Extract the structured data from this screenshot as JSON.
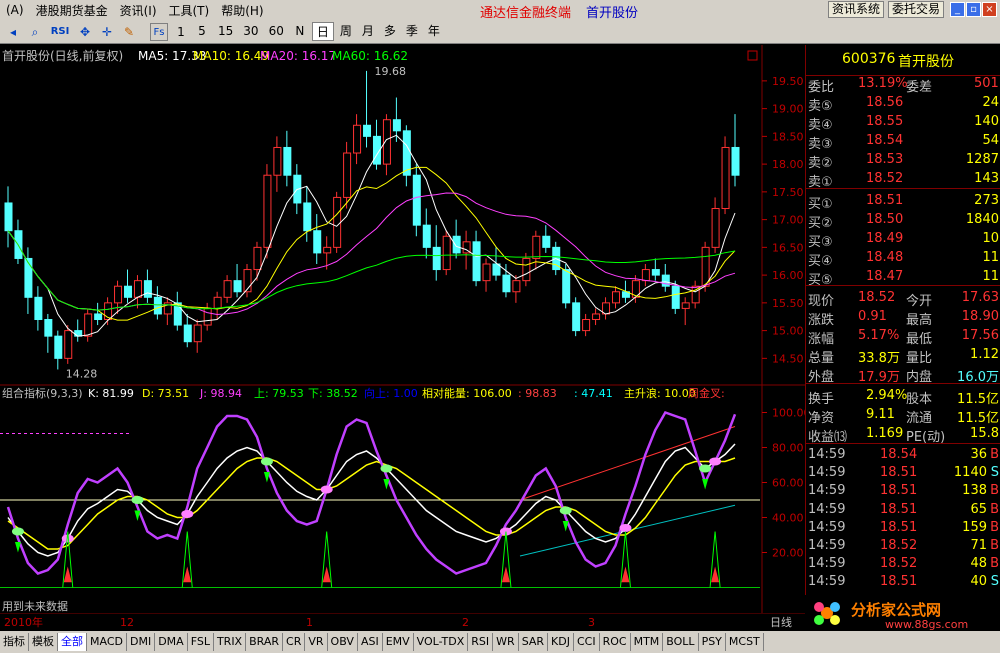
{
  "menu": {
    "items": [
      "(A)",
      "港股期货基金",
      "资讯(I)",
      "工具(T)",
      "帮助(H)"
    ],
    "center_title": "通达信金融终端",
    "center_stock": "首开股份",
    "right_buttons": [
      "资讯系统",
      "委托交易"
    ]
  },
  "toolbar": {
    "periods": [
      "5",
      "15",
      "30",
      "60",
      "N",
      "日",
      "周",
      "月",
      "多",
      "季",
      "年"
    ],
    "selected": "日",
    "icons": [
      "back-icon",
      "magnifier-icon",
      "rsi-icon",
      "pan-icon",
      "cross-icon",
      "pencil-icon",
      "fs-icon",
      "1-icon"
    ],
    "rsi_label": "RSI",
    "fs_label": "Fs",
    "one_label": "1"
  },
  "main_chart": {
    "header": "首开股份(日线,前复权)",
    "ma": [
      {
        "label": "MA5: 17.33",
        "color": "#ffffff"
      },
      {
        "label": "MA10: 16.49",
        "color": "#ffff00"
      },
      {
        "label": "MA20: 16.17",
        "color": "#ff40ff"
      },
      {
        "label": "MA60: 16.62",
        "color": "#00ff00"
      }
    ],
    "high_label": "19.68",
    "low_label": "14.28",
    "y_ticks": [
      "19.50",
      "19.00",
      "18.50",
      "18.00",
      "17.50",
      "17.00",
      "16.50",
      "16.00",
      "15.50",
      "15.00",
      "14.50"
    ],
    "ylim": [
      14.2,
      19.75
    ],
    "colors": {
      "up": "#ff3232",
      "down": "#54ffff",
      "ma5": "#ffffff",
      "ma10": "#ffff00",
      "ma20": "#ff40ff",
      "ma60": "#00ff00"
    }
  },
  "indicator": {
    "header_name": "组合指标(9,3,3)",
    "items": [
      {
        "label": "K: 81.99",
        "color": "#ffffff"
      },
      {
        "label": "D: 73.51",
        "color": "#ffff00"
      },
      {
        "label": "J: 98.94",
        "color": "#ff40ff"
      },
      {
        "label": "上: 79.53",
        "color": "#00ff00"
      },
      {
        "label": "下: 38.52",
        "color": "#00ff00"
      },
      {
        "label": "向上: 1.00",
        "color": "#0000ff"
      },
      {
        "label": "相对能量: 106.00",
        "color": "#ffff00"
      },
      {
        "label": ": 98.83",
        "color": "#ff4040"
      },
      {
        "label": ": 47.41",
        "color": "#00ffff"
      },
      {
        "label": "主升浪: 10.00",
        "color": "#ffff00"
      },
      {
        "label": "周金叉:",
        "color": "#ff3232"
      }
    ],
    "y_ticks": [
      "100.00",
      "80.00",
      "60.00",
      "40.00",
      "20.00"
    ],
    "ylim": [
      -10,
      110
    ],
    "footer_note": "用到未来数据"
  },
  "x_axis": {
    "labels": [
      "2010年",
      "12",
      "1",
      "2",
      "3",
      "日线"
    ]
  },
  "chart_data": [
    {
      "type": "candlestick",
      "title": "首开股份(日线,前复权)",
      "ylim": [
        14.2,
        19.75
      ],
      "candles": [
        [
          17.3,
          17.6,
          16.5,
          16.8
        ],
        [
          16.8,
          17.0,
          16.2,
          16.3
        ],
        [
          16.3,
          16.5,
          15.3,
          15.6
        ],
        [
          15.6,
          15.8,
          15.0,
          15.2
        ],
        [
          15.2,
          15.3,
          14.6,
          14.9
        ],
        [
          14.9,
          15.0,
          14.3,
          14.5
        ],
        [
          14.5,
          15.1,
          14.4,
          15.0
        ],
        [
          15.0,
          15.2,
          14.8,
          14.9
        ],
        [
          14.9,
          15.4,
          14.8,
          15.3
        ],
        [
          15.3,
          15.5,
          15.1,
          15.2
        ],
        [
          15.2,
          15.6,
          15.1,
          15.5
        ],
        [
          15.5,
          15.9,
          15.3,
          15.8
        ],
        [
          15.8,
          16.1,
          15.5,
          15.6
        ],
        [
          15.6,
          16.0,
          15.4,
          15.9
        ],
        [
          15.9,
          16.1,
          15.5,
          15.6
        ],
        [
          15.6,
          15.8,
          15.2,
          15.3
        ],
        [
          15.3,
          15.6,
          15.1,
          15.5
        ],
        [
          15.5,
          15.7,
          15.0,
          15.1
        ],
        [
          15.1,
          15.3,
          14.7,
          14.8
        ],
        [
          14.8,
          15.2,
          14.6,
          15.1
        ],
        [
          15.1,
          15.5,
          15.0,
          15.4
        ],
        [
          15.4,
          15.7,
          15.2,
          15.6
        ],
        [
          15.6,
          16.0,
          15.5,
          15.9
        ],
        [
          15.9,
          16.2,
          15.6,
          15.7
        ],
        [
          15.7,
          16.2,
          15.6,
          16.1
        ],
        [
          16.1,
          16.6,
          15.9,
          16.5
        ],
        [
          16.5,
          18.0,
          16.3,
          17.8
        ],
        [
          17.8,
          18.5,
          17.5,
          18.3
        ],
        [
          18.3,
          18.6,
          17.6,
          17.8
        ],
        [
          17.8,
          18.0,
          17.1,
          17.3
        ],
        [
          17.3,
          17.6,
          16.6,
          16.8
        ],
        [
          16.8,
          17.1,
          16.2,
          16.4
        ],
        [
          16.4,
          16.7,
          16.1,
          16.5
        ],
        [
          16.5,
          17.5,
          16.4,
          17.4
        ],
        [
          17.4,
          18.4,
          17.2,
          18.2
        ],
        [
          18.2,
          18.9,
          18.0,
          18.7
        ],
        [
          18.7,
          19.68,
          18.3,
          18.5
        ],
        [
          18.5,
          18.8,
          17.9,
          18.0
        ],
        [
          18.0,
          18.9,
          17.8,
          18.8
        ],
        [
          18.8,
          19.2,
          18.4,
          18.6
        ],
        [
          18.6,
          18.7,
          17.6,
          17.8
        ],
        [
          17.8,
          18.0,
          16.7,
          16.9
        ],
        [
          16.9,
          17.2,
          16.3,
          16.5
        ],
        [
          16.5,
          16.9,
          15.9,
          16.1
        ],
        [
          16.1,
          16.8,
          16.0,
          16.7
        ],
        [
          16.7,
          17.0,
          16.3,
          16.4
        ],
        [
          16.4,
          16.8,
          16.1,
          16.6
        ],
        [
          16.6,
          16.8,
          15.8,
          15.9
        ],
        [
          15.9,
          16.3,
          15.7,
          16.2
        ],
        [
          16.2,
          16.5,
          15.9,
          16.0
        ],
        [
          16.0,
          16.2,
          15.6,
          15.7
        ],
        [
          15.7,
          16.0,
          15.5,
          15.9
        ],
        [
          15.9,
          16.4,
          15.8,
          16.3
        ],
        [
          16.3,
          16.8,
          16.1,
          16.7
        ],
        [
          16.7,
          16.9,
          16.4,
          16.5
        ],
        [
          16.5,
          16.6,
          16.0,
          16.1
        ],
        [
          16.1,
          16.2,
          15.4,
          15.5
        ],
        [
          15.5,
          15.6,
          14.9,
          15.0
        ],
        [
          15.0,
          15.3,
          14.9,
          15.2
        ],
        [
          15.2,
          15.4,
          15.1,
          15.3
        ],
        [
          15.3,
          15.6,
          15.2,
          15.5
        ],
        [
          15.5,
          15.8,
          15.4,
          15.7
        ],
        [
          15.7,
          15.9,
          15.5,
          15.6
        ],
        [
          15.6,
          16.0,
          15.5,
          15.9
        ],
        [
          15.9,
          16.2,
          15.8,
          16.1
        ],
        [
          16.1,
          16.3,
          15.9,
          16.0
        ],
        [
          16.0,
          16.2,
          15.7,
          15.8
        ],
        [
          15.8,
          15.9,
          15.3,
          15.4
        ],
        [
          15.4,
          15.6,
          15.1,
          15.5
        ],
        [
          15.5,
          15.9,
          15.4,
          15.8
        ],
        [
          15.8,
          16.6,
          15.7,
          16.5
        ],
        [
          16.5,
          17.4,
          16.4,
          17.2
        ],
        [
          17.2,
          18.5,
          17.1,
          18.3
        ],
        [
          18.3,
          18.9,
          17.6,
          17.8
        ]
      ]
    },
    {
      "type": "line",
      "title": "组合指标(9,3,3)",
      "ylim": [
        -10,
        110
      ],
      "series": [
        {
          "name": "K",
          "values": [
            40,
            32,
            25,
            20,
            18,
            20,
            28,
            38,
            45,
            48,
            52,
            56,
            55,
            50,
            44,
            40,
            38,
            36,
            42,
            52,
            60,
            68,
            74,
            78,
            80,
            78,
            72,
            66,
            60,
            55,
            52,
            50,
            56,
            64,
            72,
            76,
            78,
            74,
            68,
            62,
            56,
            50,
            44,
            40,
            36,
            32,
            30,
            28,
            26,
            28,
            32,
            36,
            42,
            48,
            52,
            50,
            44,
            38,
            32,
            28,
            26,
            28,
            34,
            42,
            52,
            62,
            72,
            78,
            80,
            74,
            68,
            72,
            76,
            82
          ]
        },
        {
          "name": "D",
          "values": [
            38,
            34,
            30,
            26,
            22,
            22,
            24,
            30,
            36,
            42,
            46,
            50,
            52,
            52,
            50,
            46,
            42,
            40,
            40,
            44,
            50,
            56,
            62,
            68,
            72,
            74,
            74,
            72,
            68,
            64,
            60,
            56,
            56,
            58,
            62,
            66,
            70,
            72,
            70,
            68,
            64,
            60,
            56,
            52,
            48,
            44,
            40,
            36,
            32,
            30,
            30,
            32,
            36,
            40,
            44,
            46,
            46,
            44,
            40,
            36,
            32,
            30,
            30,
            34,
            40,
            48,
            56,
            64,
            70,
            72,
            72,
            72,
            72,
            74
          ]
        },
        {
          "name": "J",
          "values": [
            46,
            28,
            14,
            8,
            10,
            16,
            36,
            54,
            62,
            60,
            64,
            68,
            60,
            46,
            32,
            28,
            30,
            28,
            46,
            68,
            80,
            92,
            98,
            98,
            96,
            86,
            68,
            54,
            44,
            38,
            36,
            38,
            56,
            76,
            92,
            96,
            94,
            78,
            64,
            50,
            40,
            30,
            22,
            16,
            12,
            8,
            10,
            12,
            14,
            24,
            36,
            44,
            54,
            64,
            68,
            58,
            40,
            26,
            16,
            12,
            14,
            24,
            42,
            58,
            76,
            90,
            100,
            98,
            96,
            78,
            60,
            72,
            84,
            99
          ]
        }
      ],
      "annotations": [
        "用到未来数据"
      ]
    }
  ],
  "sidepanel": {
    "title_code": "600376",
    "title_name": "首开股份",
    "weibi_label": "委比",
    "weibi_value": "13.19%",
    "weicha_label": "委差",
    "weicha_value": "501",
    "sell": [
      {
        "label": "卖⑤",
        "price": "18.56",
        "vol": "24"
      },
      {
        "label": "卖④",
        "price": "18.55",
        "vol": "140"
      },
      {
        "label": "卖③",
        "price": "18.54",
        "vol": "54"
      },
      {
        "label": "卖②",
        "price": "18.53",
        "vol": "1287"
      },
      {
        "label": "卖①",
        "price": "18.52",
        "vol": "143"
      }
    ],
    "buy": [
      {
        "label": "买①",
        "price": "18.51",
        "vol": "273"
      },
      {
        "label": "买②",
        "price": "18.50",
        "vol": "1840"
      },
      {
        "label": "买③",
        "price": "18.49",
        "vol": "10"
      },
      {
        "label": "买④",
        "price": "18.48",
        "vol": "11"
      },
      {
        "label": "买⑤",
        "price": "18.47",
        "vol": "11"
      }
    ],
    "quote": [
      {
        "l1": "现价",
        "v1": "18.52",
        "c1": "#ff3232",
        "l2": "今开",
        "v2": "17.63",
        "c2": "#ff3232"
      },
      {
        "l1": "涨跌",
        "v1": "0.91",
        "c1": "#ff3232",
        "l2": "最高",
        "v2": "18.90",
        "c2": "#ff3232"
      },
      {
        "l1": "涨幅",
        "v1": "5.17%",
        "c1": "#ff3232",
        "l2": "最低",
        "v2": "17.56",
        "c2": "#ff3232"
      },
      {
        "l1": "总量",
        "v1": "33.8万",
        "c1": "#ffff00",
        "l2": "量比",
        "v2": "1.12",
        "c2": "#ffff00"
      },
      {
        "l1": "外盘",
        "v1": "17.9万",
        "c1": "#ff3232",
        "l2": "内盘",
        "v2": "16.0万",
        "c2": "#54ffff"
      }
    ],
    "stats": [
      {
        "l1": "换手",
        "v1": "2.94%",
        "l2": "股本",
        "v2": "11.5亿"
      },
      {
        "l1": "净资",
        "v1": "9.11",
        "l2": "流通",
        "v2": "11.5亿"
      },
      {
        "l1": "收益⒀",
        "v1": "1.169",
        "l2": "PE(动)",
        "v2": "15.8"
      }
    ],
    "ticks": [
      {
        "time": "14:59",
        "price": "18.54",
        "vol": "36",
        "flag": "B",
        "fc": "#ff3232"
      },
      {
        "time": "14:59",
        "price": "18.51",
        "vol": "1140",
        "flag": "S",
        "fc": "#54ffff"
      },
      {
        "time": "14:59",
        "price": "18.51",
        "vol": "138",
        "flag": "B",
        "fc": "#ff3232"
      },
      {
        "time": "14:59",
        "price": "18.51",
        "vol": "65",
        "flag": "B",
        "fc": "#ff3232"
      },
      {
        "time": "14:59",
        "price": "18.51",
        "vol": "159",
        "flag": "B",
        "fc": "#ff3232"
      },
      {
        "time": "14:59",
        "price": "18.52",
        "vol": "71",
        "flag": "B",
        "fc": "#ff3232"
      },
      {
        "time": "14:59",
        "price": "18.52",
        "vol": "48",
        "flag": "B",
        "fc": "#ff3232"
      },
      {
        "time": "14:59",
        "price": "18.51",
        "vol": "40",
        "flag": "S",
        "fc": "#54ffff"
      }
    ],
    "logo_text": "分析家公式网",
    "logo_url": "www.88gs.com"
  },
  "bottom_tabs": [
    "指标",
    "模板",
    "全部",
    "MACD",
    "DMI",
    "DMA",
    "FSL",
    "TRIX",
    "BRAR",
    "CR",
    "VR",
    "OBV",
    "ASI",
    "EMV",
    "VOL-TDX",
    "RSI",
    "WR",
    "SAR",
    "KDJ",
    "CCI",
    "ROC",
    "MTM",
    "BOLL",
    "PSY",
    "MCST"
  ],
  "bottom_selected": "全部"
}
